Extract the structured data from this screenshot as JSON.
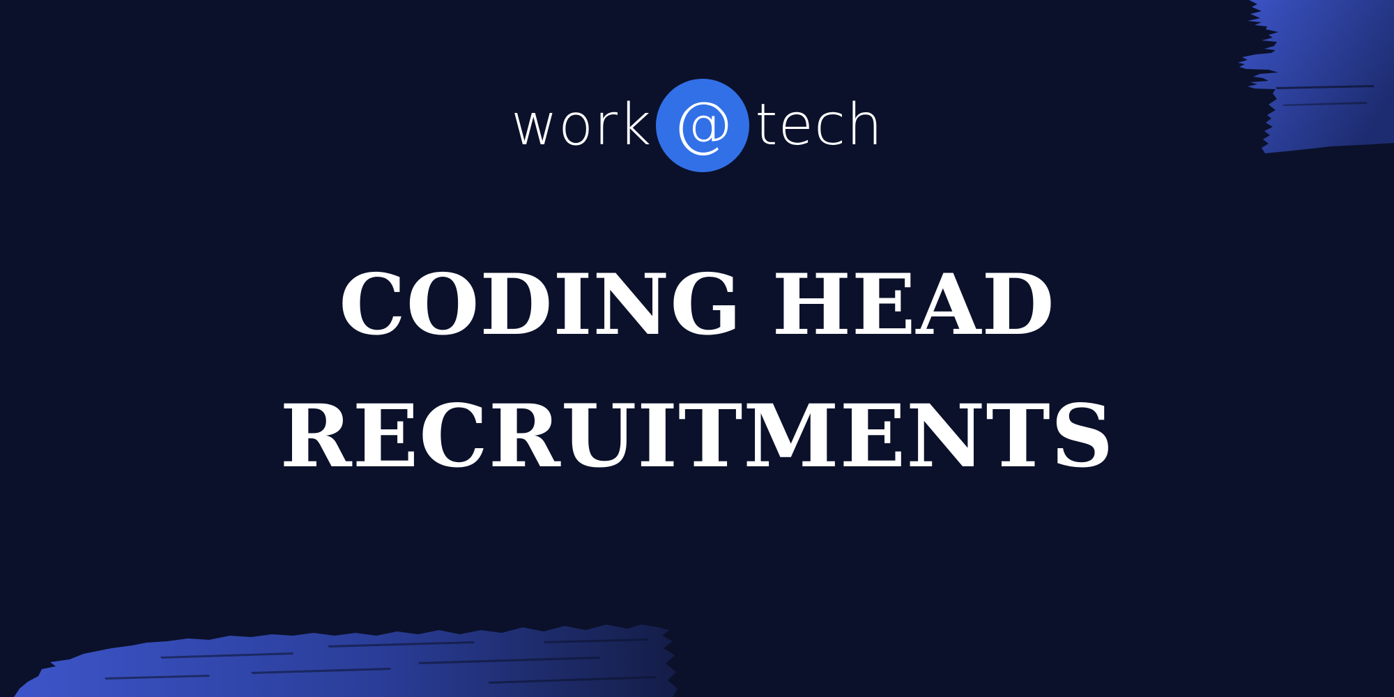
{
  "logo": {
    "word_left": "work",
    "at_symbol": "@",
    "word_right": "tech"
  },
  "headline": {
    "line1": "CODING HEAD",
    "line2": "RECRUITMENTS"
  },
  "colors": {
    "background": "#0b112a",
    "logo_circle": "#3270e8",
    "text": "#ffffff",
    "brush_light": "#3d55c9",
    "brush_dark": "#1a2a6c"
  }
}
